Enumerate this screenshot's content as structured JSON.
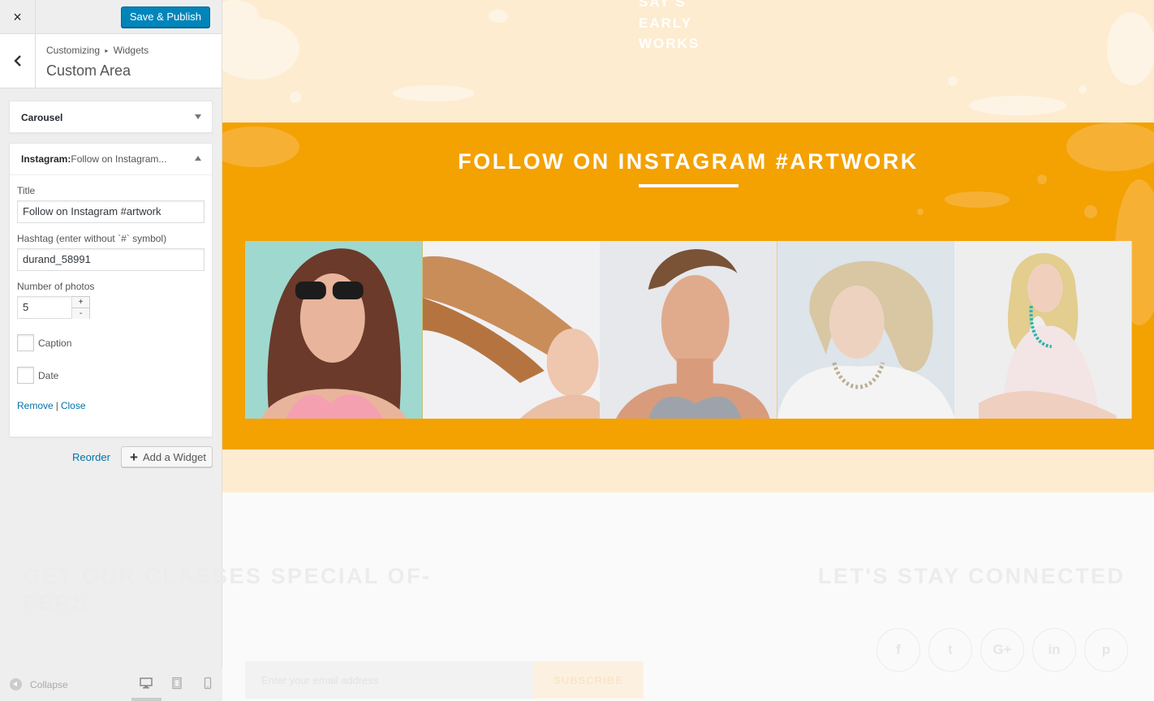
{
  "sidebar": {
    "close_icon": "×",
    "publish_label": "Save & Publish",
    "breadcrumb": {
      "root": "Customizing",
      "separator": "▸",
      "current": "Widgets"
    },
    "section_title": "Custom Area",
    "widgets": {
      "carousel": {
        "title": "Carousel"
      },
      "instagram": {
        "title_prefix": "Instagram:",
        "title_sub": " Follow on Instagram...",
        "fields": {
          "title_label": "Title",
          "title_value": "Follow on Instagram #artwork",
          "hashtag_label": "Hashtag (enter without `#` symbol)",
          "hashtag_value": "durand_58991",
          "photos_label": "Number of photos",
          "photos_value": "5",
          "stepper_up": "+",
          "stepper_down": "-",
          "caption_label": "Caption",
          "date_label": "Date"
        },
        "remove_label": "Remove",
        "link_separator": "|",
        "close_label": "Close"
      }
    },
    "reorder_label": "Reorder",
    "add_widget_label": "Add a Widget",
    "collapse_label": "Collapse",
    "devices": [
      "desktop-icon",
      "tablet-icon",
      "mobile-icon"
    ]
  },
  "preview": {
    "works_lines": [
      "SAY'S",
      "EARLY",
      "WORKS"
    ],
    "instagram_heading": "FOLLOW ON INSTAGRAM #ARTWORK",
    "offers_heading": "GET OUR CLASSES SPECIAL OF-FERS",
    "email_placeholder": "Enter your email address",
    "subscribe_label": "SUBSCRIBE",
    "connect_heading": "LET'S STAY CONNECTED",
    "social_icons": [
      "f",
      "t",
      "G+",
      "in",
      "p"
    ],
    "colors": {
      "orange": "#f4a102",
      "peach": "#fdecd0",
      "accent_blue": "#0085ba"
    }
  }
}
